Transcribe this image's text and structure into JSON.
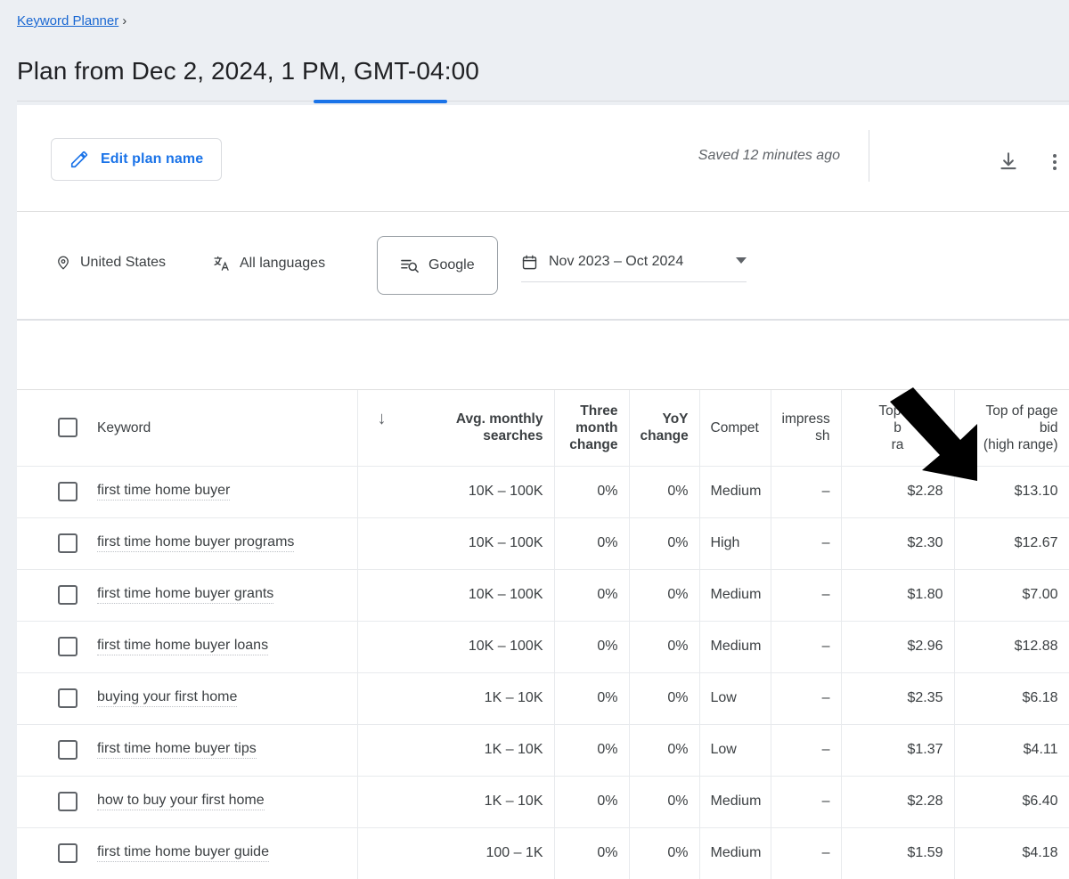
{
  "breadcrumb": {
    "label": "Keyword Planner",
    "separator": "›"
  },
  "page": {
    "title": "Plan from Dec 2, 2024, 1 PM, GMT-04:00"
  },
  "toolbar": {
    "edit_plan_label": "Edit plan name",
    "edit_icon": "pencil-icon",
    "saved_status": "Saved 12 minutes ago",
    "download_icon": "download-icon",
    "more_icon": "more-vert-icon"
  },
  "filters": {
    "location": {
      "icon": "location-pin-icon",
      "label": "United States"
    },
    "language": {
      "icon": "translate-icon",
      "label": "All languages"
    },
    "network": {
      "icon": "search-network-icon",
      "label": "Google"
    },
    "date_range": {
      "icon": "calendar-icon",
      "label": "Nov 2023 – Oct 2024",
      "caret": "chevron-down-icon"
    }
  },
  "table": {
    "sort_icon": "arrow-down-icon",
    "headers": {
      "keyword": "Keyword",
      "avg_monthly_searches": "Avg. monthly searches",
      "three_month_change": "Three month change",
      "yoy_change": "YoY change",
      "competition": "Competition",
      "ad_impression_share": "Ad impression share",
      "top_of_page_bid_low": "Top of page bid (low range)",
      "top_of_page_bid_high": "Top of page bid (high range)"
    },
    "headers_visible": {
      "competition": "Compet",
      "ad_impression_share_line1": "impress",
      "ad_impression_share_line2": "sh",
      "top_of_page_bid_low_line1": "Top of",
      "top_of_page_bid_low_line2": "b",
      "top_of_page_bid_low_line3": "ra",
      "top_of_page_bid_high_line1": "Top of page bid",
      "top_of_page_bid_high_line2": "(high range)"
    },
    "rows": [
      {
        "keyword": "first time home buyer",
        "avg": "10K – 100K",
        "three_month": "0%",
        "yoy": "0%",
        "competition": "Medium",
        "impression_share": "–",
        "bid_low": "$2.28",
        "bid_high": "$13.10"
      },
      {
        "keyword": "first time home buyer programs",
        "avg": "10K – 100K",
        "three_month": "0%",
        "yoy": "0%",
        "competition": "High",
        "impression_share": "–",
        "bid_low": "$2.30",
        "bid_high": "$12.67"
      },
      {
        "keyword": "first time home buyer grants",
        "avg": "10K – 100K",
        "three_month": "0%",
        "yoy": "0%",
        "competition": "Medium",
        "impression_share": "–",
        "bid_low": "$1.80",
        "bid_high": "$7.00"
      },
      {
        "keyword": "first time home buyer loans",
        "avg": "10K – 100K",
        "three_month": "0%",
        "yoy": "0%",
        "competition": "Medium",
        "impression_share": "–",
        "bid_low": "$2.96",
        "bid_high": "$12.88"
      },
      {
        "keyword": "buying your first home",
        "avg": "1K – 10K",
        "three_month": "0%",
        "yoy": "0%",
        "competition": "Low",
        "impression_share": "–",
        "bid_low": "$2.35",
        "bid_high": "$6.18"
      },
      {
        "keyword": "first time home buyer tips",
        "avg": "1K – 10K",
        "three_month": "0%",
        "yoy": "0%",
        "competition": "Low",
        "impression_share": "–",
        "bid_low": "$1.37",
        "bid_high": "$4.11"
      },
      {
        "keyword": "how to buy your first home",
        "avg": "1K – 10K",
        "three_month": "0%",
        "yoy": "0%",
        "competition": "Medium",
        "impression_share": "–",
        "bid_low": "$2.28",
        "bid_high": "$6.40"
      },
      {
        "keyword": "first time home buyer guide",
        "avg": "100 – 1K",
        "three_month": "0%",
        "yoy": "0%",
        "competition": "Medium",
        "impression_share": "–",
        "bid_low": "$1.59",
        "bid_high": "$4.18"
      }
    ]
  },
  "annotation": {
    "arrow_icon": "black-arrow-pointing-down-right"
  },
  "colors": {
    "accent_blue": "#1a73e8",
    "link_blue": "#1967d2",
    "page_background": "#eceff3",
    "card_background": "#ffffff",
    "text_primary": "#202124",
    "text_secondary": "#5f6368",
    "border": "#e8eaed"
  }
}
